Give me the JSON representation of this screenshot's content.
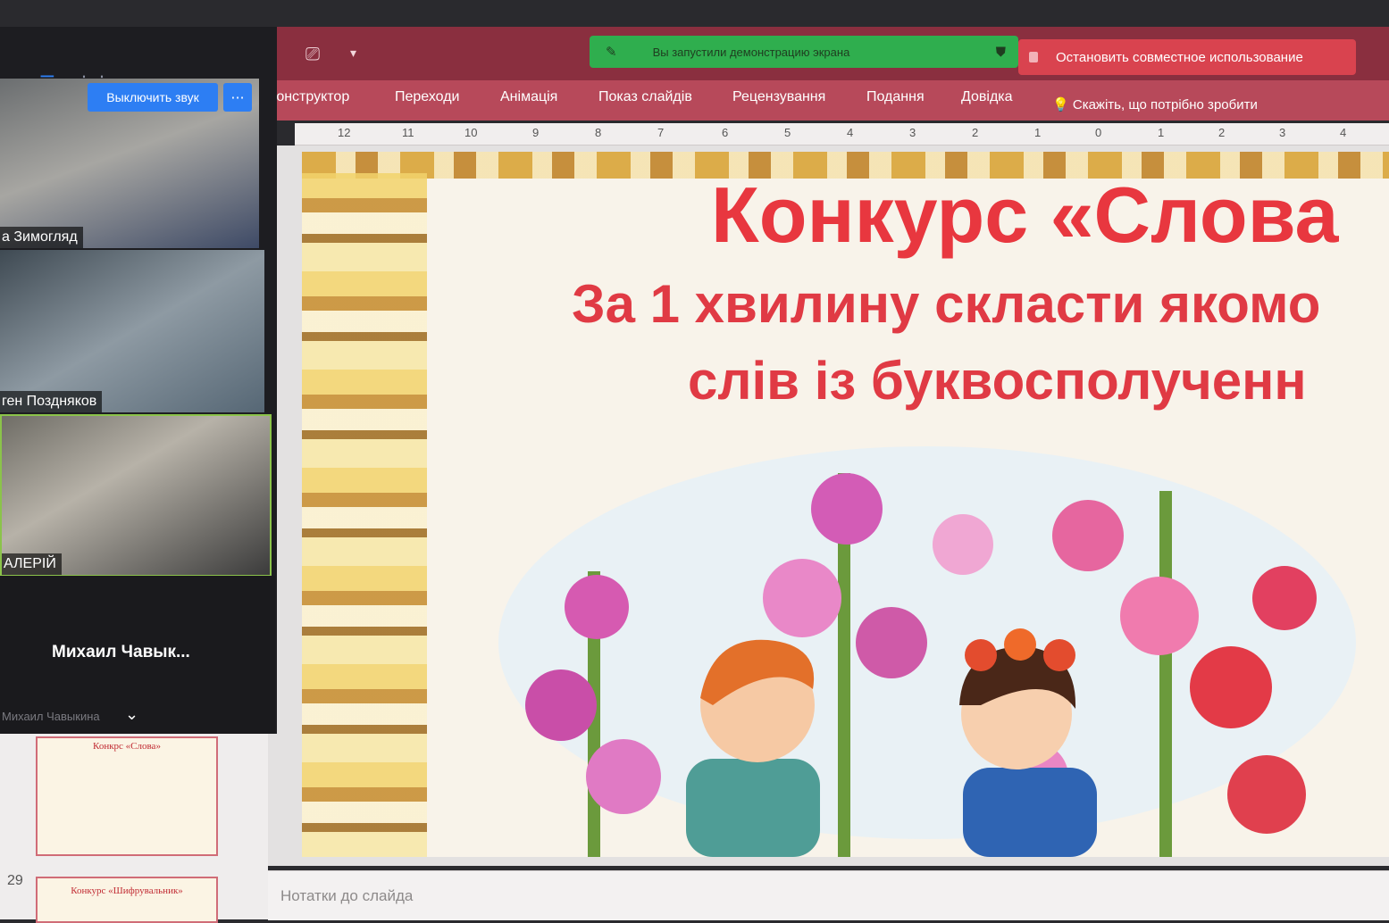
{
  "powerpoint": {
    "tabs": [
      "Конструктор",
      "Переходи",
      "Анімація",
      "Показ слайдів",
      "Рецензування",
      "Подання",
      "Довідка"
    ],
    "tell_me": "Скажіть, що потрібно зробити",
    "ruler_labels": [
      "12",
      "11",
      "10",
      "9",
      "8",
      "7",
      "6",
      "5",
      "4",
      "3",
      "2",
      "1",
      "0",
      "1",
      "2",
      "3",
      "4"
    ],
    "notes_placeholder": "Нотатки до слайда",
    "slide_number": "29"
  },
  "zoom": {
    "share_banner": "Вы запустили демонстрацию экрана",
    "stop_share": "Остановить совместное использование",
    "mute_button": "Выключить звук",
    "more_button": "···",
    "participants": [
      {
        "name": "а Зимогляд"
      },
      {
        "name": "ген Поздняков"
      },
      {
        "name": "АЛЕРІЙ"
      }
    ],
    "audio_participant": {
      "name": "Михаил  Чавык...",
      "sub": "Михаил Чавыкина"
    }
  },
  "slide": {
    "title": "Конкурс «Слова",
    "line1": "За 1 хвилину скласти якомо",
    "line2": "слів із буквосполученн"
  },
  "thumbnails": [
    {
      "title": "Конкрс «Слова»"
    },
    {
      "title": "Конкурс «Шифрувальник»"
    }
  ]
}
